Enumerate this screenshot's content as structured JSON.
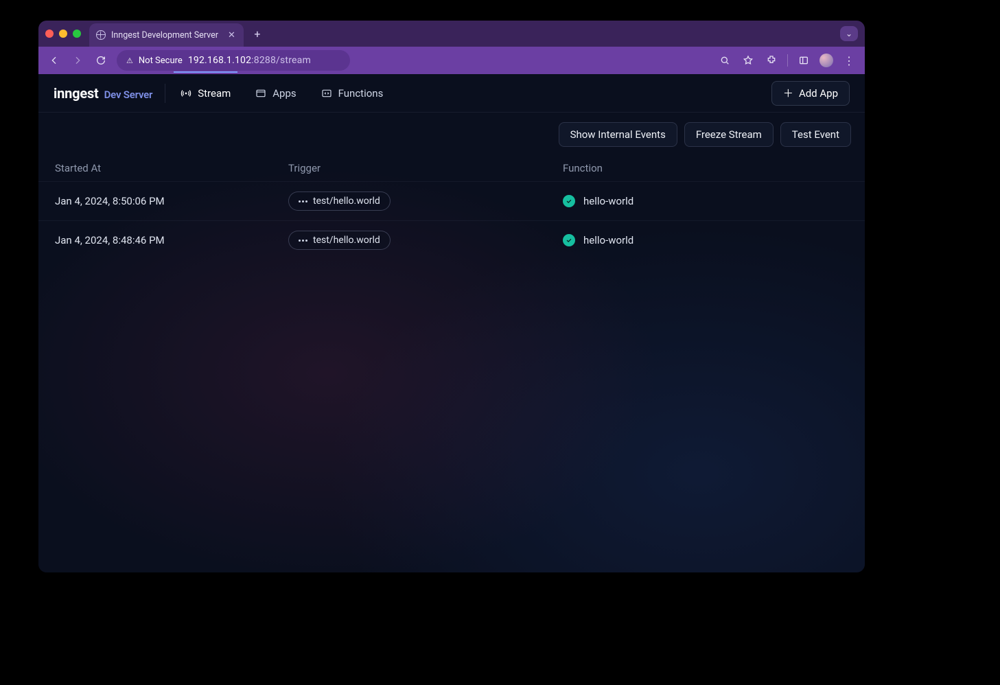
{
  "browser": {
    "tab_title": "Inngest Development Server",
    "not_secure_label": "Not Secure",
    "url_host": "192.168.1.102",
    "url_port_path": ":8288/stream"
  },
  "brand": {
    "logo": "inngest",
    "sub": "Dev Server"
  },
  "nav": {
    "stream": "Stream",
    "apps": "Apps",
    "functions": "Functions",
    "add_app": "Add App"
  },
  "actions": {
    "show_internal": "Show Internal Events",
    "freeze": "Freeze Stream",
    "test_event": "Test Event"
  },
  "table": {
    "headers": {
      "started_at": "Started At",
      "trigger": "Trigger",
      "function": "Function"
    },
    "rows": [
      {
        "started_at": "Jan 4, 2024, 8:50:06 PM",
        "trigger": "test/hello.world",
        "function": "hello-world"
      },
      {
        "started_at": "Jan 4, 2024, 8:48:46 PM",
        "trigger": "test/hello.world",
        "function": "hello-world"
      }
    ]
  }
}
